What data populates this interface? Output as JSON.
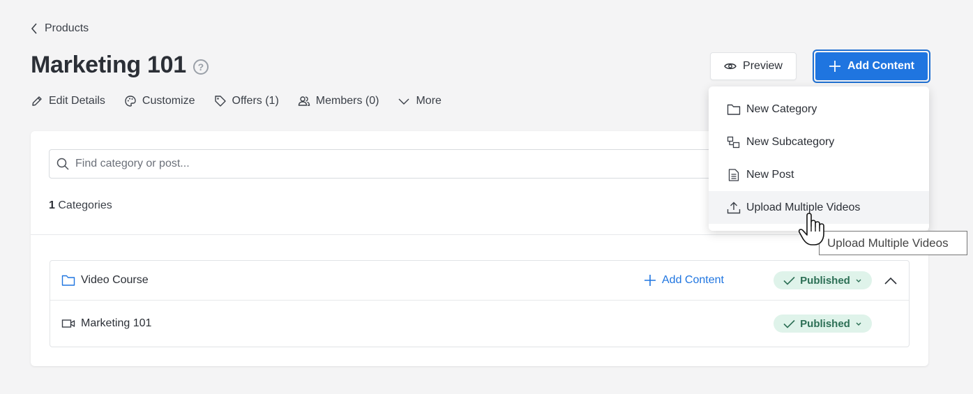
{
  "breadcrumb": {
    "label": "Products"
  },
  "header": {
    "title": "Marketing 101"
  },
  "actions": [
    {
      "label": "Edit Details",
      "icon": "pencil-icon"
    },
    {
      "label": "Customize",
      "icon": "palette-icon"
    },
    {
      "label": "Offers (1)",
      "icon": "tag-icon"
    },
    {
      "label": "Members (0)",
      "icon": "users-icon"
    },
    {
      "label": "More",
      "icon": "chevron-down-icon"
    }
  ],
  "buttons": {
    "preview": "Preview",
    "add_content": "Add Content"
  },
  "search": {
    "placeholder": "Find category or post..."
  },
  "count": {
    "number": "1",
    "label": "Categories"
  },
  "rows": [
    {
      "name": "Video Course",
      "icon": "folder-icon",
      "add_label": "Add Content",
      "status": "Published"
    },
    {
      "name": "Marketing 101",
      "icon": "video-icon",
      "status": "Published"
    }
  ],
  "dropdown": {
    "items": [
      {
        "label": "New Category",
        "icon": "folder-icon"
      },
      {
        "label": "New Subcategory",
        "icon": "subcategory-icon"
      },
      {
        "label": "New Post",
        "icon": "document-icon"
      },
      {
        "label": "Upload Multiple Videos",
        "icon": "upload-icon"
      }
    ]
  },
  "tooltip": {
    "text": "Upload Multiple Videos"
  },
  "colors": {
    "primary": "#1f75e0",
    "published_bg": "#dff3ea",
    "published_text": "#2c6f55"
  }
}
